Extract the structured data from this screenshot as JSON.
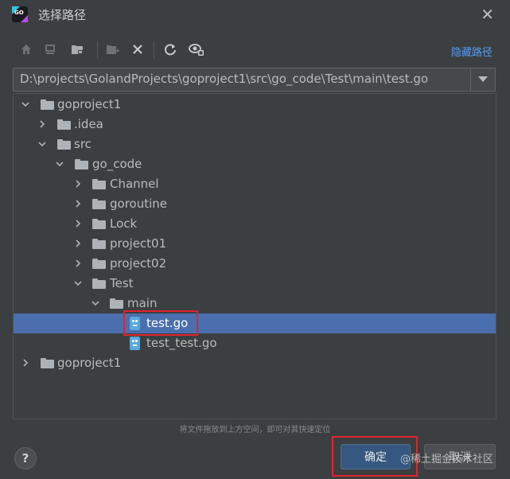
{
  "window": {
    "title": "选择路径",
    "app_icon_text": "GO"
  },
  "toolbar": {
    "buttons": [
      "home-icon",
      "desktop-icon",
      "project-folder-icon",
      "new-folder-icon",
      "delete-icon",
      "refresh-icon",
      "show-hidden-icon"
    ],
    "hide_path_label": "隐藏路径"
  },
  "path": {
    "value": "D:\\projects\\GolandProjects\\goproject1\\src\\go_code\\Test\\main\\test.go"
  },
  "tree": {
    "items": [
      {
        "label": "goproject1",
        "type": "folder",
        "expanded": true
      },
      {
        "label": ".idea",
        "type": "folder",
        "expanded": false
      },
      {
        "label": "src",
        "type": "folder",
        "expanded": true
      },
      {
        "label": "go_code",
        "type": "folder",
        "expanded": true
      },
      {
        "label": "Channel",
        "type": "folder",
        "expanded": false
      },
      {
        "label": "goroutine",
        "type": "folder",
        "expanded": false
      },
      {
        "label": "Lock",
        "type": "folder",
        "expanded": false
      },
      {
        "label": "project01",
        "type": "folder",
        "expanded": false
      },
      {
        "label": "project02",
        "type": "folder",
        "expanded": false
      },
      {
        "label": "Test",
        "type": "folder",
        "expanded": true
      },
      {
        "label": "main",
        "type": "folder",
        "expanded": true
      },
      {
        "label": "test.go",
        "type": "go-file",
        "selected": true
      },
      {
        "label": "test_test.go",
        "type": "go-file"
      },
      {
        "label": "goproject1",
        "type": "folder",
        "expanded": false
      }
    ]
  },
  "hint": "将文件拖放到上方空间，即可对其快速定位",
  "footer": {
    "help_label": "?",
    "ok_label": "确定",
    "cancel_label": "取消"
  },
  "watermark": "@稀土掘金技术社区",
  "colors": {
    "background": "#3c3f41",
    "selection": "#4b6eaf",
    "link": "#589df6",
    "highlight_border": "#e0242c",
    "ok_button": "#365880"
  }
}
